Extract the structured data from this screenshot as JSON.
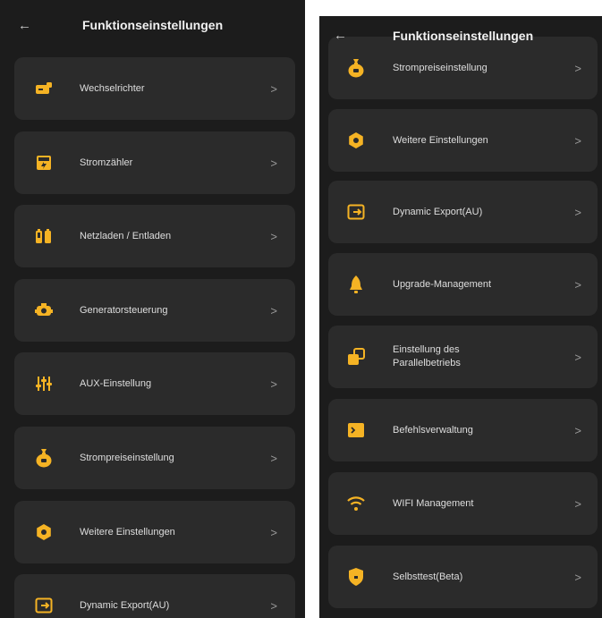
{
  "colors": {
    "background": "#1c1c1c",
    "card": "#2b2b2b",
    "accent": "#f5b324",
    "text": "#dedede"
  },
  "left": {
    "back_icon": "←",
    "title": "Funktionseinstellungen",
    "items": [
      {
        "label": "Wechselrichter",
        "icon": "inverter-icon"
      },
      {
        "label": "Stromzähler",
        "icon": "meter-icon"
      },
      {
        "label": "Netzladen / Entladen",
        "icon": "battery-icon"
      },
      {
        "label": "Generatorsteuerung",
        "icon": "generator-icon"
      },
      {
        "label": "AUX-Einstellung",
        "icon": "sliders-icon"
      },
      {
        "label": "Strompreiseinstellung",
        "icon": "money-bag-icon"
      },
      {
        "label": "Weitere Einstellungen",
        "icon": "gear-icon"
      },
      {
        "label": "Dynamic Export(AU)",
        "icon": "export-icon"
      }
    ]
  },
  "right": {
    "back_icon": "←",
    "title": "Funktionseinstellungen",
    "items": [
      {
        "label": "Strompreiseinstellung",
        "icon": "money-bag-icon"
      },
      {
        "label": "Weitere Einstellungen",
        "icon": "gear-icon"
      },
      {
        "label": "Dynamic Export(AU)",
        "icon": "export-icon"
      },
      {
        "label": "Upgrade-Management",
        "icon": "bell-icon"
      },
      {
        "label": "Einstellung des Parallelbetriebs",
        "icon": "parallel-icon"
      },
      {
        "label": "Befehlsverwaltung",
        "icon": "terminal-icon"
      },
      {
        "label": "WIFI Management",
        "icon": "wifi-icon"
      },
      {
        "label": "Selbsttest(Beta)",
        "icon": "shield-icon"
      }
    ]
  },
  "chevron": ">"
}
